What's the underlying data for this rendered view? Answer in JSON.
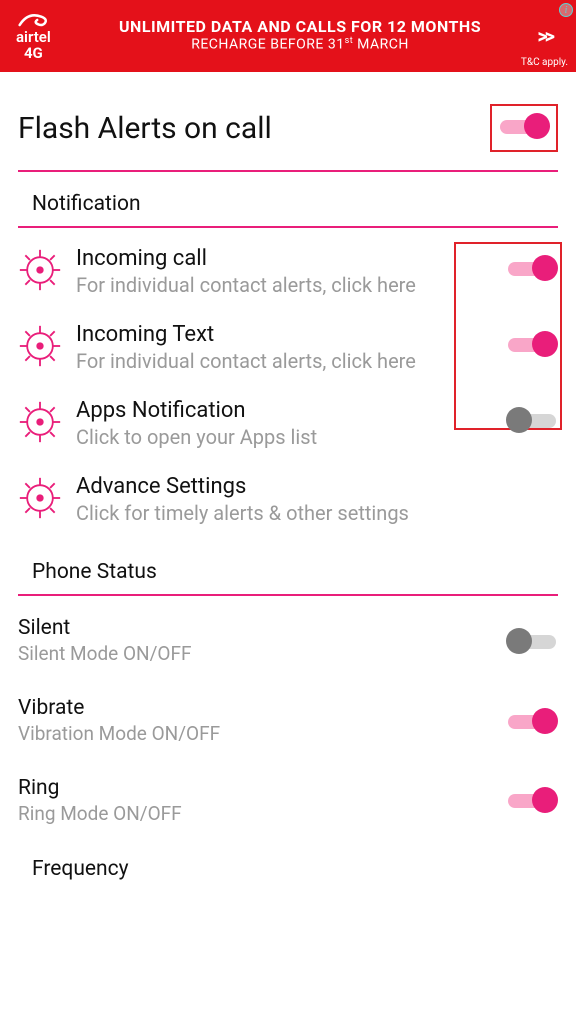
{
  "ad": {
    "brand_top": "airtel",
    "brand_bottom": "4G",
    "line1": "UNLIMITED DATA AND CALLS FOR 12 MONTHS",
    "line2_pre": "RECHARGE BEFORE 31",
    "line2_sup": "st",
    "line2_post": " MARCH",
    "arrows": ">>",
    "tc": "T&C apply."
  },
  "title": "Flash Alerts on call",
  "title_toggle_on": true,
  "sections": {
    "notification": {
      "heading": "Notification",
      "items": [
        {
          "title": "Incoming call",
          "sub": "For individual contact alerts, click here",
          "toggle": "on"
        },
        {
          "title": "Incoming Text",
          "sub": "For individual contact alerts, click here",
          "toggle": "on"
        },
        {
          "title": "Apps Notification",
          "sub": "Click to open your Apps list",
          "toggle": "off"
        },
        {
          "title": "Advance Settings",
          "sub": "Click for timely alerts & other settings",
          "toggle": null
        }
      ]
    },
    "phone_status": {
      "heading": "Phone Status",
      "items": [
        {
          "title": "Silent",
          "sub": "Silent Mode ON/OFF",
          "toggle": "off"
        },
        {
          "title": "Vibrate",
          "sub": "Vibration Mode ON/OFF",
          "toggle": "on"
        },
        {
          "title": "Ring",
          "sub": "Ring Mode ON/OFF",
          "toggle": "on"
        }
      ]
    },
    "frequency": {
      "heading": "Frequency"
    }
  },
  "colors": {
    "accent": "#e91e7a",
    "ad_bg": "#e4111a"
  }
}
